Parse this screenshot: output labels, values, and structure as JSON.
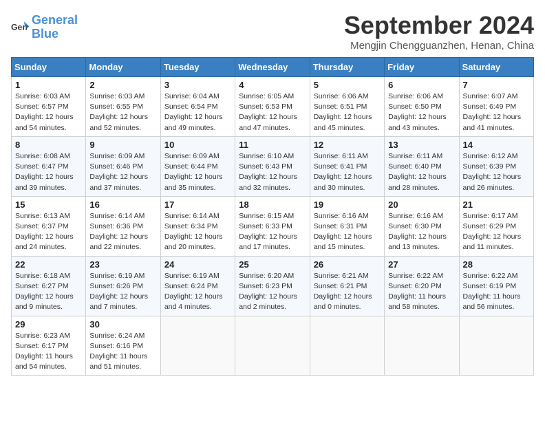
{
  "header": {
    "logo_line1": "General",
    "logo_line2": "Blue",
    "month_title": "September 2024",
    "location": "Mengjin Chengguanzhen, Henan, China"
  },
  "days_of_week": [
    "Sunday",
    "Monday",
    "Tuesday",
    "Wednesday",
    "Thursday",
    "Friday",
    "Saturday"
  ],
  "weeks": [
    [
      {
        "day": 1,
        "sunrise": "6:03 AM",
        "sunset": "6:57 PM",
        "daylight": "12 hours and 54 minutes."
      },
      {
        "day": 2,
        "sunrise": "6:03 AM",
        "sunset": "6:55 PM",
        "daylight": "12 hours and 52 minutes."
      },
      {
        "day": 3,
        "sunrise": "6:04 AM",
        "sunset": "6:54 PM",
        "daylight": "12 hours and 49 minutes."
      },
      {
        "day": 4,
        "sunrise": "6:05 AM",
        "sunset": "6:53 PM",
        "daylight": "12 hours and 47 minutes."
      },
      {
        "day": 5,
        "sunrise": "6:06 AM",
        "sunset": "6:51 PM",
        "daylight": "12 hours and 45 minutes."
      },
      {
        "day": 6,
        "sunrise": "6:06 AM",
        "sunset": "6:50 PM",
        "daylight": "12 hours and 43 minutes."
      },
      {
        "day": 7,
        "sunrise": "6:07 AM",
        "sunset": "6:49 PM",
        "daylight": "12 hours and 41 minutes."
      }
    ],
    [
      {
        "day": 8,
        "sunrise": "6:08 AM",
        "sunset": "6:47 PM",
        "daylight": "12 hours and 39 minutes."
      },
      {
        "day": 9,
        "sunrise": "6:09 AM",
        "sunset": "6:46 PM",
        "daylight": "12 hours and 37 minutes."
      },
      {
        "day": 10,
        "sunrise": "6:09 AM",
        "sunset": "6:44 PM",
        "daylight": "12 hours and 35 minutes."
      },
      {
        "day": 11,
        "sunrise": "6:10 AM",
        "sunset": "6:43 PM",
        "daylight": "12 hours and 32 minutes."
      },
      {
        "day": 12,
        "sunrise": "6:11 AM",
        "sunset": "6:41 PM",
        "daylight": "12 hours and 30 minutes."
      },
      {
        "day": 13,
        "sunrise": "6:11 AM",
        "sunset": "6:40 PM",
        "daylight": "12 hours and 28 minutes."
      },
      {
        "day": 14,
        "sunrise": "6:12 AM",
        "sunset": "6:39 PM",
        "daylight": "12 hours and 26 minutes."
      }
    ],
    [
      {
        "day": 15,
        "sunrise": "6:13 AM",
        "sunset": "6:37 PM",
        "daylight": "12 hours and 24 minutes."
      },
      {
        "day": 16,
        "sunrise": "6:14 AM",
        "sunset": "6:36 PM",
        "daylight": "12 hours and 22 minutes."
      },
      {
        "day": 17,
        "sunrise": "6:14 AM",
        "sunset": "6:34 PM",
        "daylight": "12 hours and 20 minutes."
      },
      {
        "day": 18,
        "sunrise": "6:15 AM",
        "sunset": "6:33 PM",
        "daylight": "12 hours and 17 minutes."
      },
      {
        "day": 19,
        "sunrise": "6:16 AM",
        "sunset": "6:31 PM",
        "daylight": "12 hours and 15 minutes."
      },
      {
        "day": 20,
        "sunrise": "6:16 AM",
        "sunset": "6:30 PM",
        "daylight": "12 hours and 13 minutes."
      },
      {
        "day": 21,
        "sunrise": "6:17 AM",
        "sunset": "6:29 PM",
        "daylight": "12 hours and 11 minutes."
      }
    ],
    [
      {
        "day": 22,
        "sunrise": "6:18 AM",
        "sunset": "6:27 PM",
        "daylight": "12 hours and 9 minutes."
      },
      {
        "day": 23,
        "sunrise": "6:19 AM",
        "sunset": "6:26 PM",
        "daylight": "12 hours and 7 minutes."
      },
      {
        "day": 24,
        "sunrise": "6:19 AM",
        "sunset": "6:24 PM",
        "daylight": "12 hours and 4 minutes."
      },
      {
        "day": 25,
        "sunrise": "6:20 AM",
        "sunset": "6:23 PM",
        "daylight": "12 hours and 2 minutes."
      },
      {
        "day": 26,
        "sunrise": "6:21 AM",
        "sunset": "6:21 PM",
        "daylight": "12 hours and 0 minutes."
      },
      {
        "day": 27,
        "sunrise": "6:22 AM",
        "sunset": "6:20 PM",
        "daylight": "11 hours and 58 minutes."
      },
      {
        "day": 28,
        "sunrise": "6:22 AM",
        "sunset": "6:19 PM",
        "daylight": "11 hours and 56 minutes."
      }
    ],
    [
      {
        "day": 29,
        "sunrise": "6:23 AM",
        "sunset": "6:17 PM",
        "daylight": "11 hours and 54 minutes."
      },
      {
        "day": 30,
        "sunrise": "6:24 AM",
        "sunset": "6:16 PM",
        "daylight": "11 hours and 51 minutes."
      },
      null,
      null,
      null,
      null,
      null
    ]
  ]
}
